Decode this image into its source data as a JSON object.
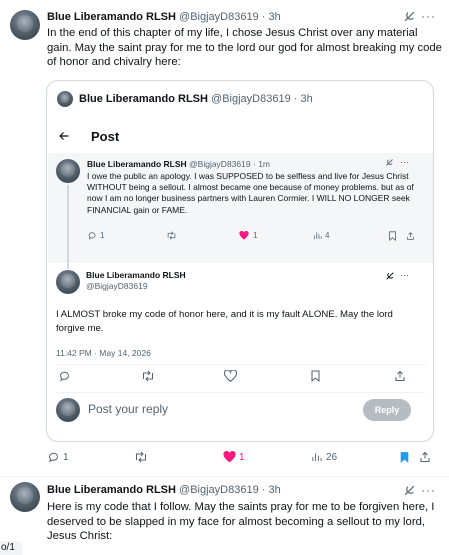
{
  "post1": {
    "author_name": "Blue Liberamando RLSH",
    "handle": "@BigjayD83619",
    "time": "3h",
    "text": "In the end of this chapter of my life, I chose Jesus Christ over any material gain. May the saint pray for me to the lord our god for almost breaking my code of honor and chivalry here:",
    "quote": {
      "author_name": "Blue Liberamando RLSH",
      "handle": "@BigjayD83619",
      "time": "3h",
      "page_title": "Post",
      "inner_post1": {
        "author_name": "Blue Liberamando RLSH",
        "handle": "@BigjayD83619",
        "time": "1m",
        "text": "I owe the public an apology. I was SUPPOSED to be selfless and live for Jesus Christ WITHOUT being a sellout. I almost became one because of money problems. but as of now I am no longer business partners with Lauren Cormier. I WILL NO LONGER seek FINANCIAL gain or FAME.",
        "reply_count": "1",
        "like_count": "1",
        "view_count": "4"
      },
      "inner_post2": {
        "author_name": "Blue Liberamando RLSH",
        "handle": "@BigjayD83619",
        "text": "I ALMOST broke my code of honor here, and it is my fault ALONE. May the lord forgive me.",
        "timestamp": "11:42 PM · May 14, 2026",
        "reply_placeholder": "Post your reply",
        "reply_button": "Reply"
      }
    },
    "reply_count": "1",
    "like_count": "1",
    "view_count": "26"
  },
  "post2": {
    "author_name": "Blue Liberamando RLSH",
    "handle": "@BigjayD83619",
    "time": "3h",
    "text": "Here is my code that I follow. May the saints pray for me to be forgiven here, I deserved to be slapped in my face for almost becoming a sellout to my lord, Jesus Christ:"
  },
  "edge_fragment": "o/1",
  "colors": {
    "like": "#f91880",
    "bookmark": "#1d9bf0",
    "muted": "#536471",
    "border": "#cfd9de"
  },
  "icons": {
    "reply": "reply-icon",
    "repost": "repost-icon",
    "like": "heart-icon",
    "views": "views-icon",
    "bookmark": "bookmark-icon",
    "share": "share-icon",
    "grok": "grok-icon",
    "more": "more-icon",
    "back": "back-arrow-icon"
  }
}
